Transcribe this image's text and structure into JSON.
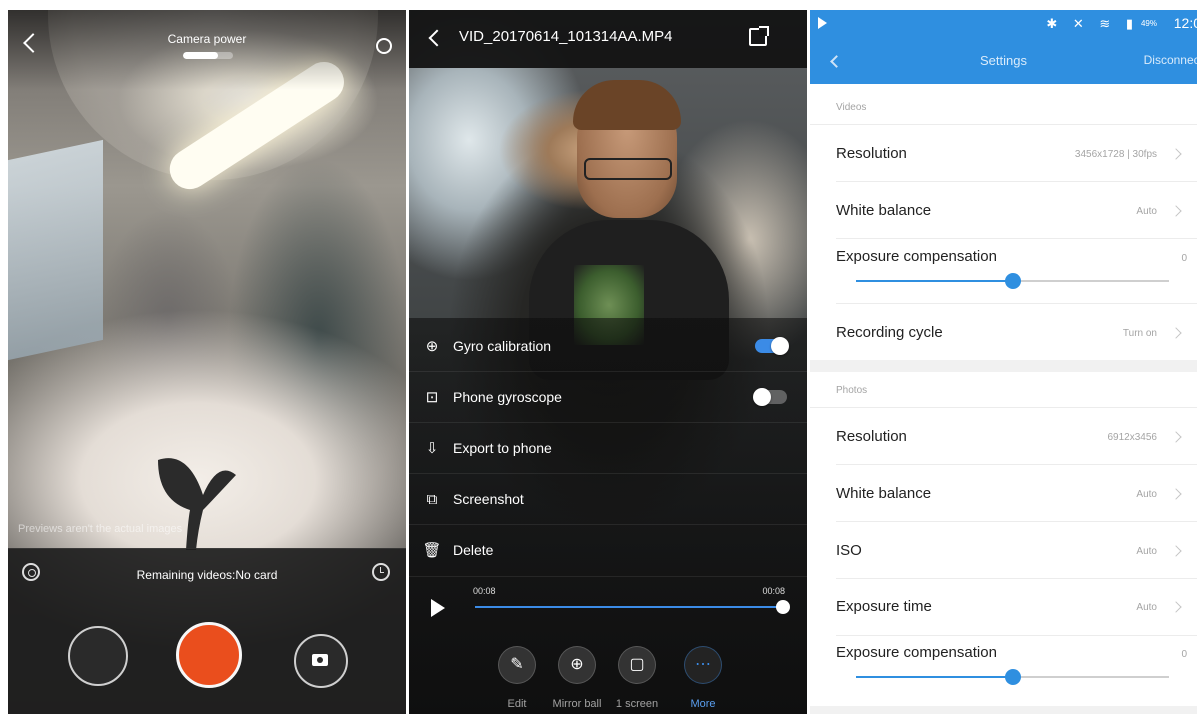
{
  "camera": {
    "power_label": "Camera power",
    "battery_level": 0.7,
    "preview_note": "Previews aren't the actual images",
    "remaining_text": "Remaining videos:No card",
    "icons": [
      "back-icon",
      "gear-icon",
      "mode-icon",
      "timer-icon",
      "camera-icon"
    ],
    "record_color": "#ea4e1d"
  },
  "video": {
    "filename": "VID_20170614_101314AA.MP4",
    "menu": [
      {
        "label": "Gyro calibration",
        "icon": "gyro-icon",
        "toggle": "on"
      },
      {
        "label": "Phone gyroscope",
        "icon": "phone-icon",
        "toggle": "off"
      },
      {
        "label": "Export to phone",
        "icon": "export-icon"
      },
      {
        "label": "Screenshot",
        "icon": "screenshot-icon"
      },
      {
        "label": "Delete",
        "icon": "trash-icon"
      }
    ],
    "time_start": "00:08",
    "time_end": "00:08",
    "progress": 1.0,
    "tools": [
      {
        "label": "Edit",
        "icon": "edit-icon",
        "active": false
      },
      {
        "label": "Mirror ball",
        "icon": "globe-icon",
        "active": false
      },
      {
        "label": "1 screen",
        "icon": "screen-icon",
        "active": false
      },
      {
        "label": "More",
        "icon": "more-icon",
        "active": true
      }
    ],
    "accent": "#3b8be6"
  },
  "settings": {
    "status": {
      "battery": "49%",
      "time": "12:0"
    },
    "title": "Settings",
    "disconnect": "Disconnect",
    "accent": "#2f8fe0",
    "videos": {
      "section": "Videos",
      "resolution_label": "Resolution",
      "resolution_value": "3456x1728 | 30fps",
      "wb_label": "White balance",
      "wb_value": "Auto",
      "ev_label": "Exposure compensation",
      "ev_value": "0",
      "ev_level": 0.5,
      "cycle_label": "Recording cycle",
      "cycle_value": "Turn on"
    },
    "photos": {
      "section": "Photos",
      "resolution_label": "Resolution",
      "resolution_value": "6912x3456",
      "wb_label": "White balance",
      "wb_value": "Auto",
      "iso_label": "ISO",
      "iso_value": "Auto",
      "exptime_label": "Exposure time",
      "exptime_value": "Auto",
      "ev_label": "Exposure compensation",
      "ev_value": "0",
      "ev_level": 0.5
    }
  }
}
